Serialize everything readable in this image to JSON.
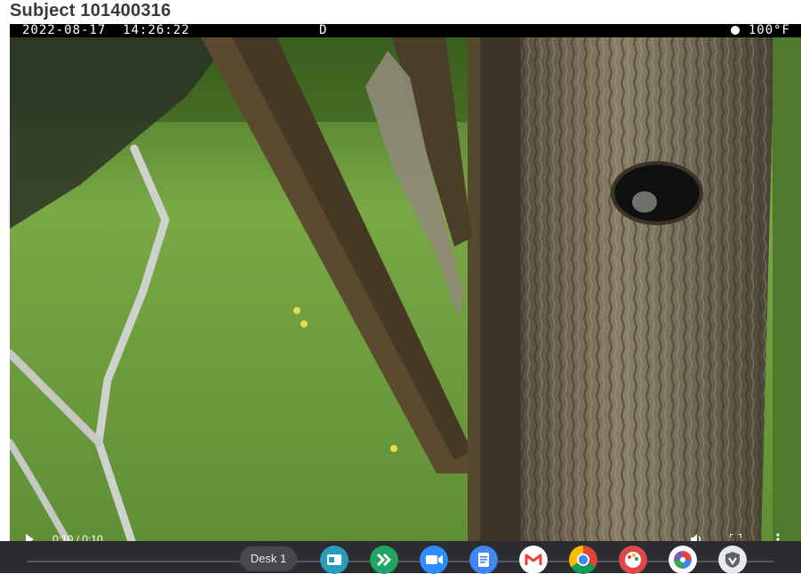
{
  "page_title": "Subject 101400316",
  "camera_overlay": {
    "timestamp": "2022-08-17  14:26:22",
    "mode": "D",
    "temperature": "100°F",
    "moon_icon": "moon-phase-icon"
  },
  "player": {
    "time": "0:10 / 0:10",
    "play_icon": "play-icon",
    "volume_icon": "volume-icon",
    "fullscreen_icon": "fullscreen-icon",
    "more_icon": "more-options-icon"
  },
  "shelf": {
    "desk_label": "Desk 1",
    "apps": [
      {
        "icon": "news-app-icon",
        "color": "#2a9dbd"
      },
      {
        "icon": "remote-desktop-icon",
        "color": "#1fa463"
      },
      {
        "icon": "zoom-video-icon",
        "color": "#2d8cff"
      },
      {
        "icon": "docs-icon",
        "color": "#4285f4"
      },
      {
        "icon": "gmail-icon",
        "color": "#ea4335"
      },
      {
        "icon": "chrome-icon",
        "color": "#fbbc04"
      },
      {
        "icon": "palette-icon",
        "color": "#e04848"
      },
      {
        "icon": "photos-app-icon",
        "color": "#7b5cc4"
      },
      {
        "icon": "shield-vpn-icon",
        "color": "#9aa0a6"
      }
    ]
  }
}
